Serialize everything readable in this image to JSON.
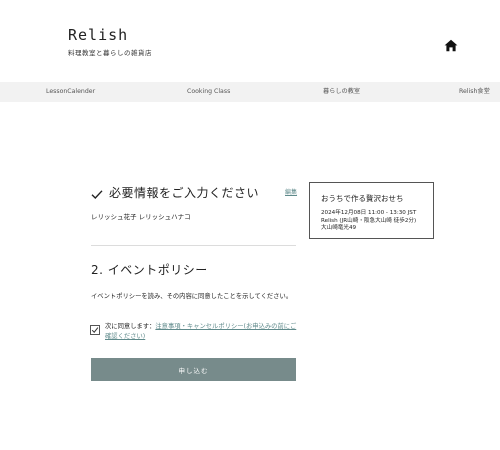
{
  "header": {
    "brand_name": "Relish",
    "tagline": "料理教室と暮らしの雑貨店",
    "home_icon": "home-icon"
  },
  "nav": {
    "items": [
      {
        "label": "LessonCalender"
      },
      {
        "label": "Cooking Class"
      },
      {
        "label": "暮らしの教室"
      },
      {
        "label": "Relish食堂"
      }
    ]
  },
  "form": {
    "section1": {
      "title": "必要情報をご入力ください",
      "edit_label": "編集",
      "check_icon": "check-icon",
      "name_value": "レリッシュ花子 レリッシュハナコ"
    },
    "section2": {
      "title": "2. イベントポリシー",
      "policy_text": "イベントポリシーを読み、その内容に同意したことを示してください。",
      "agree_prefix": "次に同意します：",
      "agree_link": "注意事項・キャンセルポリシー(お申込みの前にご確認ください)",
      "agree_checked": true
    },
    "submit_label": "申し込む"
  },
  "summary": {
    "title": "おうちで作る贅沢おせち",
    "datetime": "2024年12月08日 11:00 - 13:30 JST",
    "location_line1": "Relish (JR山崎・阪急大山崎 徒歩2分)",
    "location_line2": "大山崎竜光49"
  },
  "colors": {
    "accent": "#5f8a8b",
    "button_bg": "#778b8b",
    "nav_bg": "#f2f2f2"
  }
}
